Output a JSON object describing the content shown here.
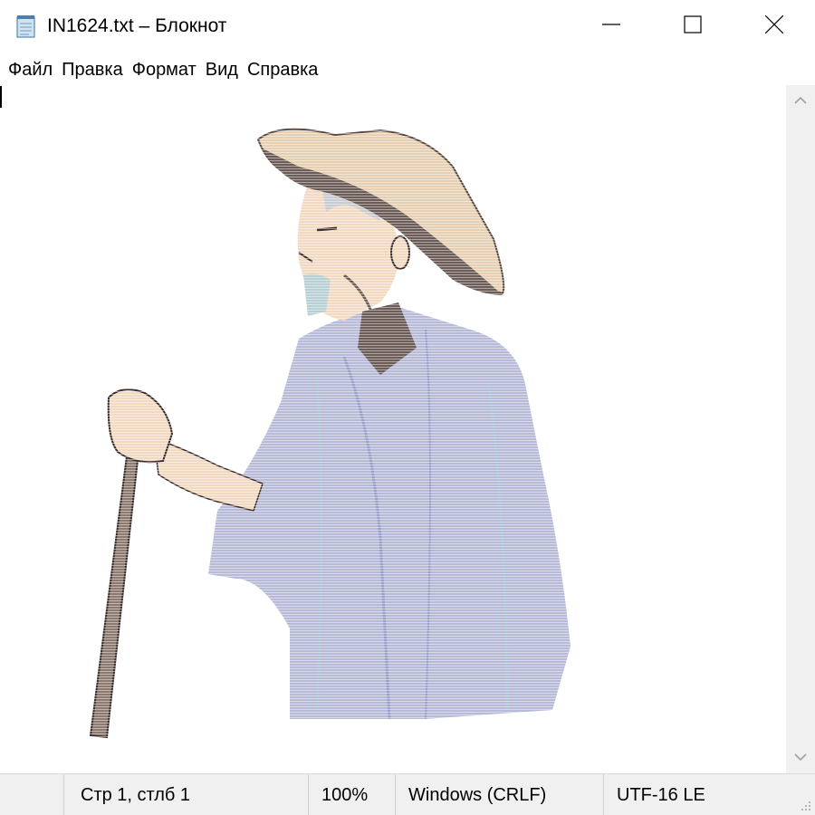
{
  "window": {
    "title": "IN1624.txt – Блокнот",
    "icon": "notepad-icon",
    "controls": [
      "minimize-icon",
      "maximize-icon",
      "close-icon"
    ]
  },
  "menu": {
    "items": [
      "Файл",
      "Правка",
      "Формат",
      "Вид",
      "Справка"
    ]
  },
  "editor": {
    "content_description_icon": "ascii-art-image",
    "colors": {
      "hat": "#e6cfb3",
      "hat_shadow": "#6b5c57",
      "skin": "#f2d9c2",
      "robe": "#b8bbd8",
      "staff": "#8c7a70",
      "beard": "#b8d0d4"
    }
  },
  "scrollbar": {
    "up": "chevron-up-icon",
    "down": "chevron-down-icon"
  },
  "status": {
    "position": "Стр 1, стлб 1",
    "zoom": "100%",
    "line_endings": "Windows (CRLF)",
    "encoding": "UTF-16 LE"
  }
}
